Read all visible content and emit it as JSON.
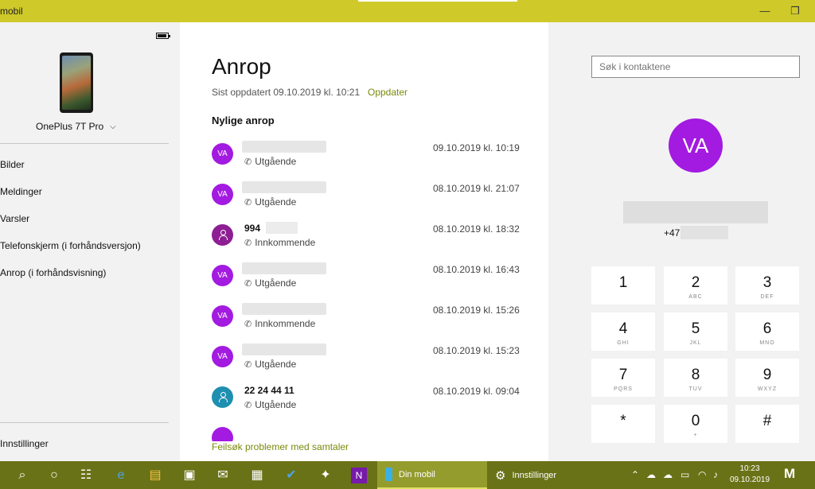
{
  "window": {
    "title": "mobil",
    "minimize_glyph": "—",
    "maximize_glyph": "❐"
  },
  "sidebar": {
    "device_name": "OnePlus 7T Pro",
    "items": [
      {
        "label": "Bilder"
      },
      {
        "label": "Meldinger"
      },
      {
        "label": "Varsler"
      },
      {
        "label": "Telefonskjerm (i forhåndsversjon)"
      },
      {
        "label": "Anrop (i forhåndsvisning)"
      }
    ],
    "settings_label": "Innstillinger"
  },
  "calls": {
    "title": "Anrop",
    "last_updated": "Sist oppdatert 09.10.2019 kl. 10:21",
    "refresh_label": "Oppdater",
    "section_title": "Nylige anrop",
    "rows": [
      {
        "avatar": "VA",
        "avatar_color": "#a31ae0",
        "name": "",
        "type": "Utgående",
        "time": "09.10.2019 kl. 10:19"
      },
      {
        "avatar": "VA",
        "avatar_color": "#a31ae0",
        "name": "",
        "type": "Utgående",
        "time": "08.10.2019 kl. 21:07"
      },
      {
        "avatar": "",
        "avatar_color": "#8d1e93",
        "name": "994",
        "type": "Innkommende",
        "time": "08.10.2019 kl. 18:32"
      },
      {
        "avatar": "VA",
        "avatar_color": "#a31ae0",
        "name": "",
        "type": "Utgående",
        "time": "08.10.2019 kl. 16:43"
      },
      {
        "avatar": "VA",
        "avatar_color": "#a31ae0",
        "name": "",
        "type": "Innkommende",
        "time": "08.10.2019 kl. 15:26"
      },
      {
        "avatar": "VA",
        "avatar_color": "#a31ae0",
        "name": "",
        "type": "Utgående",
        "time": "08.10.2019 kl. 15:23"
      },
      {
        "avatar": "",
        "avatar_color": "#1e8fb0",
        "name": "22 24 44 11",
        "type": "Utgående",
        "time": "08.10.2019 kl. 09:04"
      }
    ],
    "troubleshoot_label": "Feilsøk problemer med samtaler"
  },
  "contact": {
    "search_placeholder": "Søk i kontaktene",
    "avatar_initials": "VA",
    "avatar_color": "#a31ae0",
    "number_prefix": "+47"
  },
  "dialpad": {
    "keys": [
      {
        "digit": "1",
        "letters": ""
      },
      {
        "digit": "2",
        "letters": "ABC"
      },
      {
        "digit": "3",
        "letters": "DEF"
      },
      {
        "digit": "4",
        "letters": "GHI"
      },
      {
        "digit": "5",
        "letters": "JKL"
      },
      {
        "digit": "6",
        "letters": "MNO"
      },
      {
        "digit": "7",
        "letters": "PQRS"
      },
      {
        "digit": "8",
        "letters": "TUV"
      },
      {
        "digit": "9",
        "letters": "WXYZ"
      },
      {
        "digit": "*",
        "letters": ""
      },
      {
        "digit": "0",
        "letters": "+"
      },
      {
        "digit": "#",
        "letters": ""
      }
    ]
  },
  "taskbar": {
    "apps": [
      {
        "label": "Din mobil",
        "active": true
      },
      {
        "label": "Innstillinger",
        "active": false
      }
    ],
    "clock_time": "10:23",
    "clock_date": "09.10.2019",
    "accent_color": "#6a7217"
  },
  "colors": {
    "accent_link": "#7a8a0a",
    "title_bar": "#cfc92a"
  }
}
